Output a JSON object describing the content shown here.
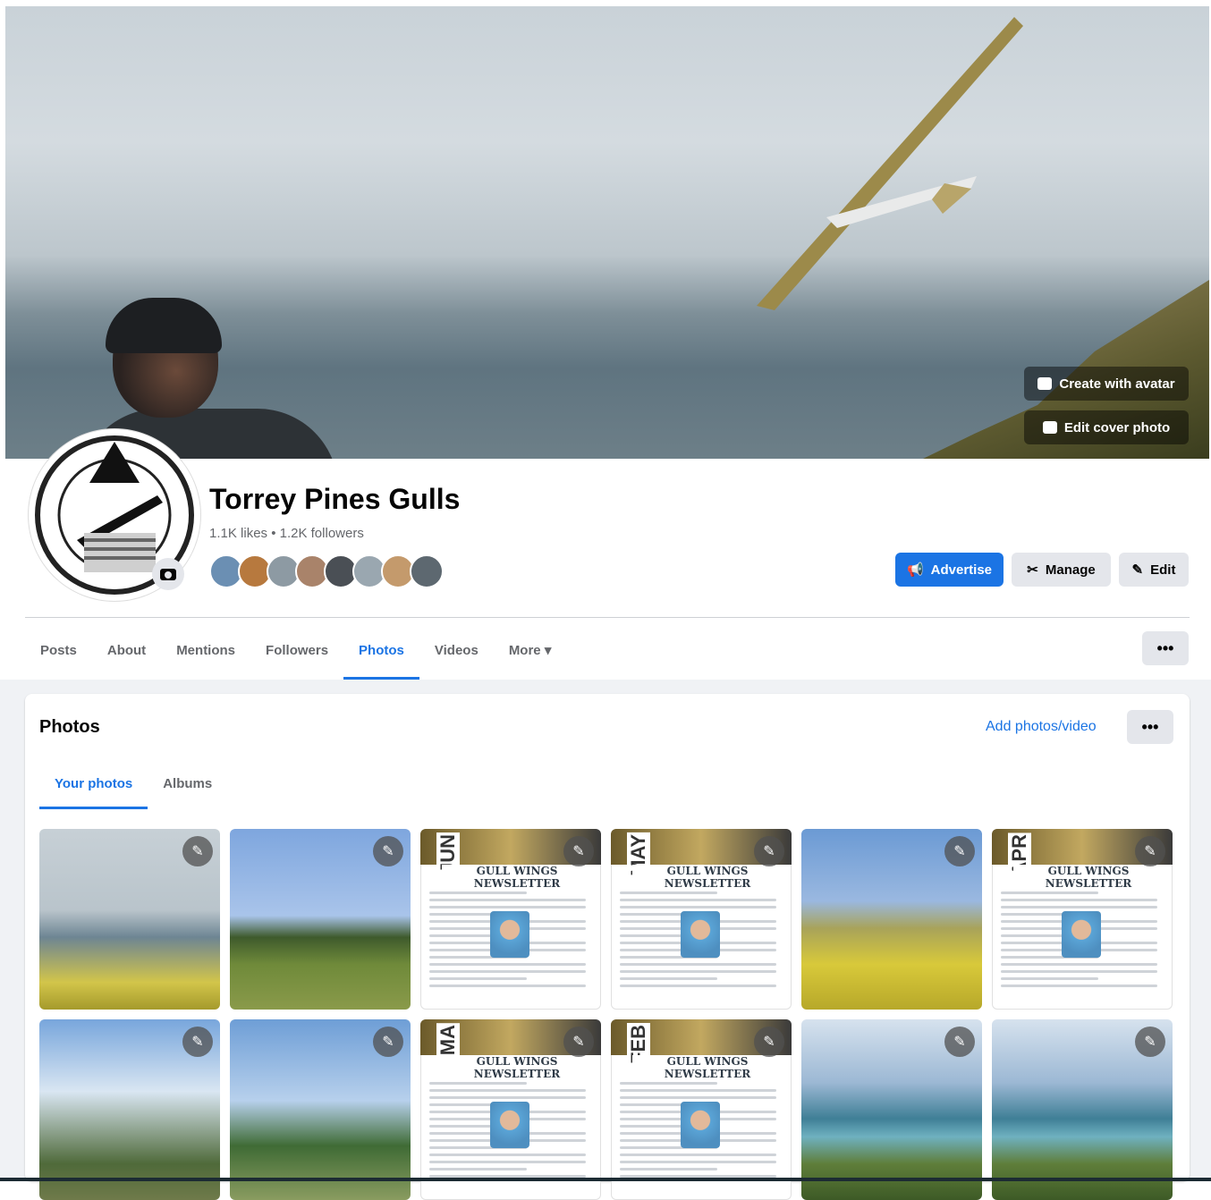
{
  "cover": {
    "create_avatar_label": "Create with avatar",
    "edit_cover_label": "Edit cover photo"
  },
  "profile": {
    "name": "Torrey Pines Gulls",
    "stats": "1.1K likes • 1.2K followers"
  },
  "actions": {
    "advertise": "Advertise",
    "manage": "Manage",
    "edit": "Edit"
  },
  "tabs": [
    {
      "label": "Posts"
    },
    {
      "label": "About"
    },
    {
      "label": "Mentions"
    },
    {
      "label": "Followers"
    },
    {
      "label": "Photos",
      "active": true
    },
    {
      "label": "Videos"
    },
    {
      "label": "More ▾"
    }
  ],
  "more_dots": "•••",
  "photos_section": {
    "title": "Photos",
    "add_link": "Add photos/video",
    "subtabs": [
      {
        "label": "Your photos",
        "active": true
      },
      {
        "label": "Albums"
      }
    ]
  },
  "photos": [
    {
      "kind": "glider-cliff"
    },
    {
      "kind": "field-flyers"
    },
    {
      "kind": "newsletter",
      "month": "JUN",
      "title": "GULL WINGS NEWSLETTER"
    },
    {
      "kind": "newsletter",
      "month": "MAY",
      "title": "GULL WINGS NEWSLETTER"
    },
    {
      "kind": "glider-flowers"
    },
    {
      "kind": "newsletter",
      "month": "APR",
      "title": "GULL WINGS NEWSLETTER"
    },
    {
      "kind": "kids-launch"
    },
    {
      "kind": "red-glider"
    },
    {
      "kind": "newsletter",
      "month": "MA",
      "title": "GULL WINGS NEWSLETTER"
    },
    {
      "kind": "newsletter",
      "month": "FEB",
      "title": "GULL WINGS NEWSLETTER"
    },
    {
      "kind": "ocean-pilot"
    },
    {
      "kind": "ocean-pilot"
    }
  ],
  "colors": {
    "accent": "#1b74e4",
    "text_secondary": "#65676b",
    "button_gray": "#e4e6eb"
  }
}
